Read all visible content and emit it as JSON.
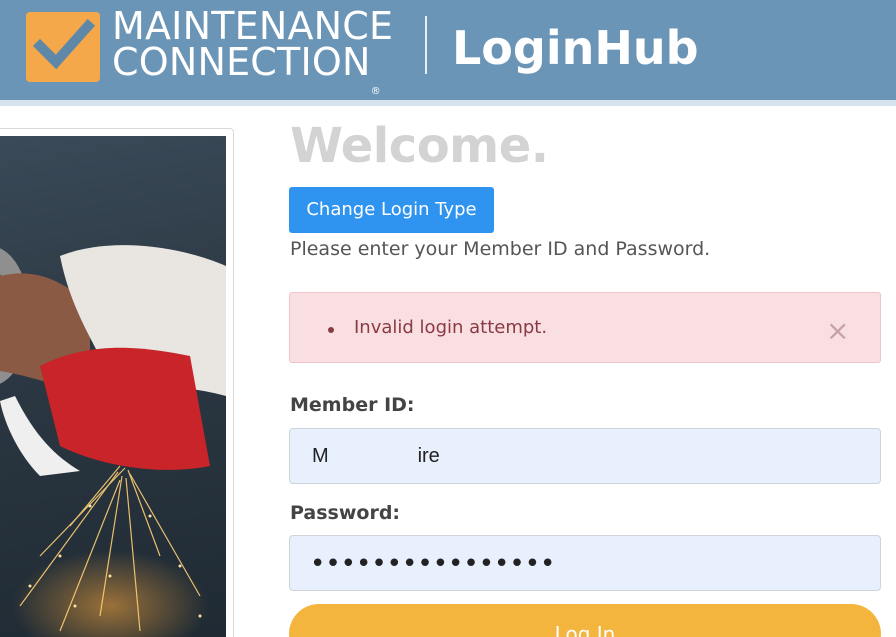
{
  "header": {
    "brand_line1": "MAINTENANCE",
    "brand_line2": "CONNECTION",
    "brand_reg": "®",
    "product": "LoginHub",
    "logo_icon": "checkmark-icon",
    "bg_color": "#6b95b6",
    "logo_color": "#f5a84a"
  },
  "main": {
    "welcome": "Welcome.",
    "change_login_label": "Change Login Type",
    "instructions": "Please enter your Member ID and Password.",
    "alert": {
      "message": "Invalid login attempt.",
      "close_icon": "close-icon",
      "close_glyph": "×"
    },
    "member_id": {
      "label": "Member ID:",
      "value": "M                ire"
    },
    "password": {
      "label": "Password:",
      "masked_value": "••••••••••••••••"
    },
    "login_label": "Log In"
  },
  "colors": {
    "primary_button": "#2f93f0",
    "alert_bg": "#f9dfe2",
    "alert_text": "#8a3a42",
    "login_button": "#f4b53f",
    "input_bg": "#e8f0fe"
  }
}
